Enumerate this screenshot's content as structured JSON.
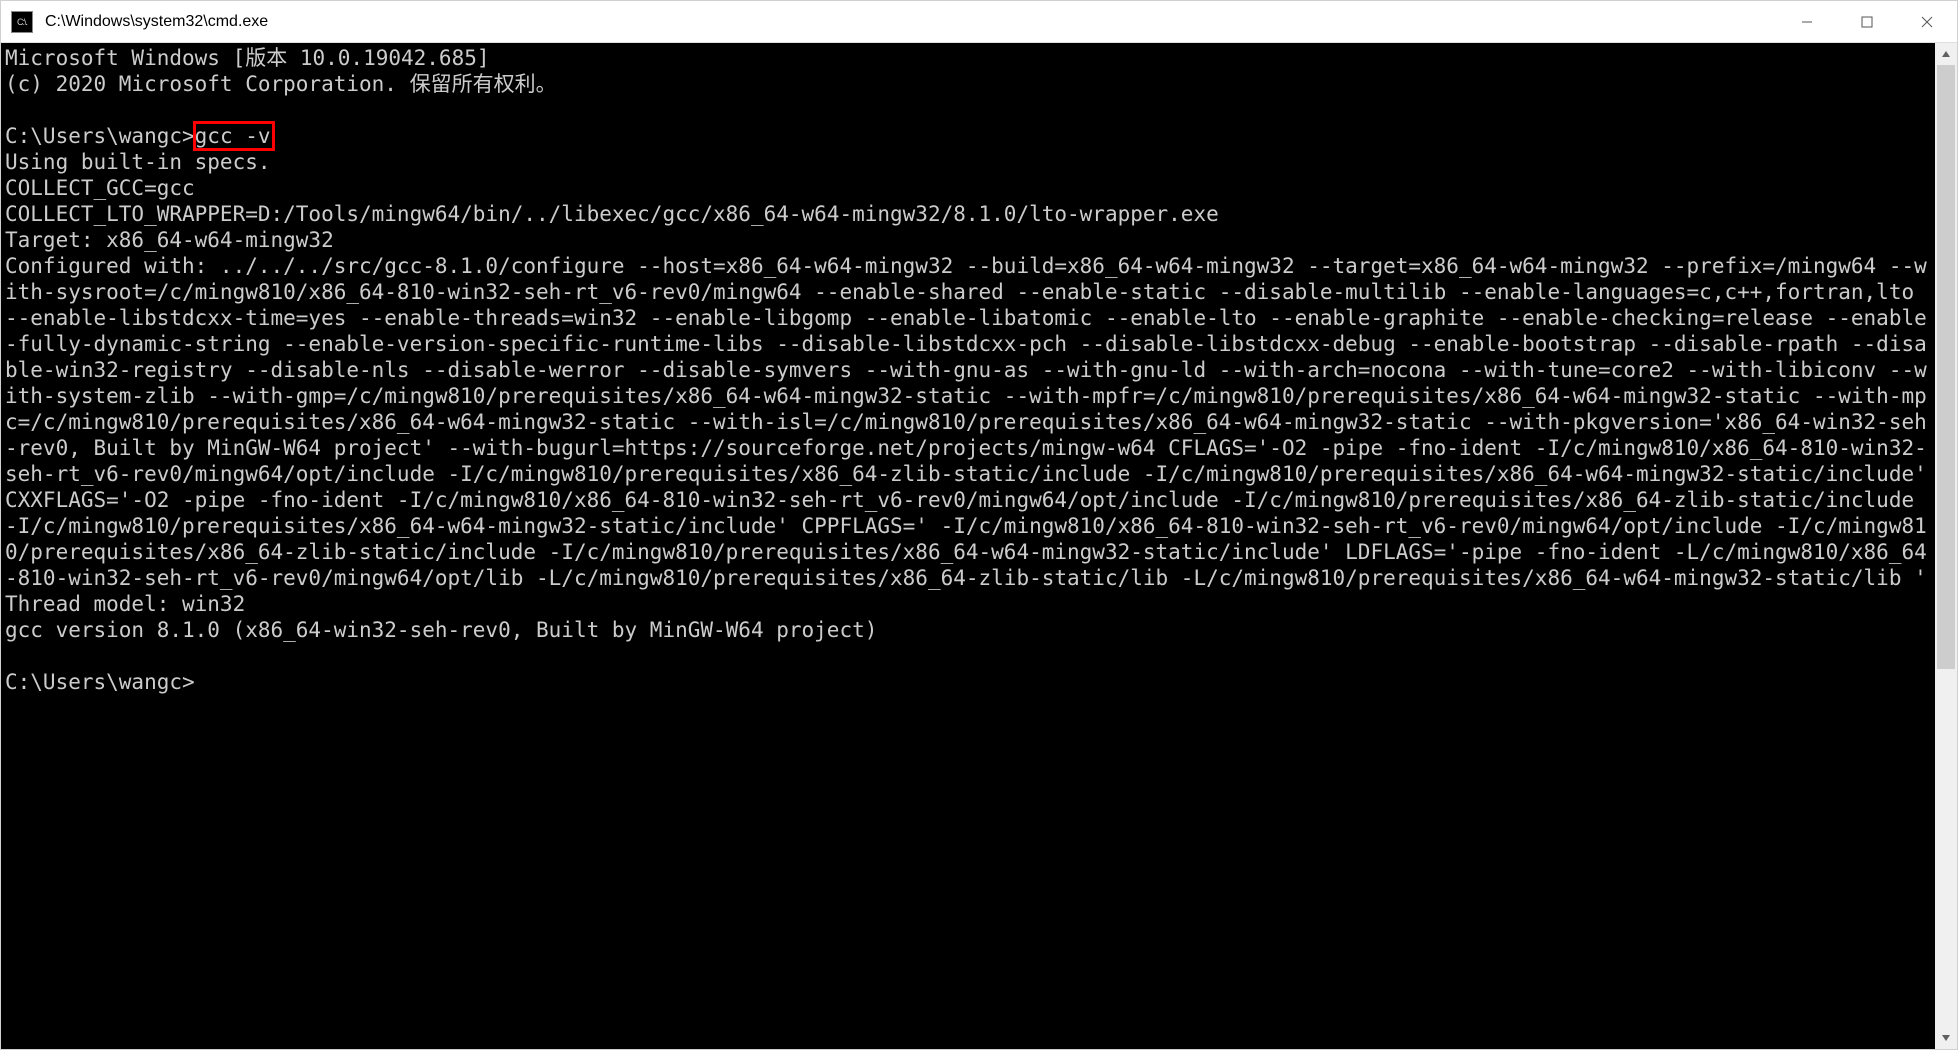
{
  "window": {
    "title": "C:\\Windows\\system32\\cmd.exe",
    "icon_text": "C:\\."
  },
  "terminal": {
    "line_version": "Microsoft Windows [版本 10.0.19042.685]",
    "line_copyright": "(c) 2020 Microsoft Corporation. 保留所有权利。",
    "prompt1_prefix": "C:\\Users\\wangc>",
    "prompt1_command": "gcc -v",
    "out_specs": "Using built-in specs.",
    "out_collect_gcc": "COLLECT_GCC=gcc",
    "out_collect_lto": "COLLECT_LTO_WRAPPER=D:/Tools/mingw64/bin/../libexec/gcc/x86_64-w64-mingw32/8.1.0/lto-wrapper.exe",
    "out_target": "Target: x86_64-w64-mingw32",
    "out_configured": "Configured with: ../../../src/gcc-8.1.0/configure --host=x86_64-w64-mingw32 --build=x86_64-w64-mingw32 --target=x86_64-w64-mingw32 --prefix=/mingw64 --with-sysroot=/c/mingw810/x86_64-810-win32-seh-rt_v6-rev0/mingw64 --enable-shared --enable-static --disable-multilib --enable-languages=c,c++,fortran,lto --enable-libstdcxx-time=yes --enable-threads=win32 --enable-libgomp --enable-libatomic --enable-lto --enable-graphite --enable-checking=release --enable-fully-dynamic-string --enable-version-specific-runtime-libs --disable-libstdcxx-pch --disable-libstdcxx-debug --enable-bootstrap --disable-rpath --disable-win32-registry --disable-nls --disable-werror --disable-symvers --with-gnu-as --with-gnu-ld --with-arch=nocona --with-tune=core2 --with-libiconv --with-system-zlib --with-gmp=/c/mingw810/prerequisites/x86_64-w64-mingw32-static --with-mpfr=/c/mingw810/prerequisites/x86_64-w64-mingw32-static --with-mpc=/c/mingw810/prerequisites/x86_64-w64-mingw32-static --with-isl=/c/mingw810/prerequisites/x86_64-w64-mingw32-static --with-pkgversion='x86_64-win32-seh-rev0, Built by MinGW-W64 project' --with-bugurl=https://sourceforge.net/projects/mingw-w64 CFLAGS='-O2 -pipe -fno-ident -I/c/mingw810/x86_64-810-win32-seh-rt_v6-rev0/mingw64/opt/include -I/c/mingw810/prerequisites/x86_64-zlib-static/include -I/c/mingw810/prerequisites/x86_64-w64-mingw32-static/include' CXXFLAGS='-O2 -pipe -fno-ident -I/c/mingw810/x86_64-810-win32-seh-rt_v6-rev0/mingw64/opt/include -I/c/mingw810/prerequisites/x86_64-zlib-static/include -I/c/mingw810/prerequisites/x86_64-w64-mingw32-static/include' CPPFLAGS=' -I/c/mingw810/x86_64-810-win32-seh-rt_v6-rev0/mingw64/opt/include -I/c/mingw810/prerequisites/x86_64-zlib-static/include -I/c/mingw810/prerequisites/x86_64-w64-mingw32-static/include' LDFLAGS='-pipe -fno-ident -L/c/mingw810/x86_64-810-win32-seh-rt_v6-rev0/mingw64/opt/lib -L/c/mingw810/prerequisites/x86_64-zlib-static/lib -L/c/mingw810/prerequisites/x86_64-w64-mingw32-static/lib '",
    "out_thread_model": "Thread model: win32",
    "out_gcc_version": "gcc version 8.1.0 (x86_64-win32-seh-rev0, Built by MinGW-W64 project)",
    "prompt2": "C:\\Users\\wangc>"
  }
}
